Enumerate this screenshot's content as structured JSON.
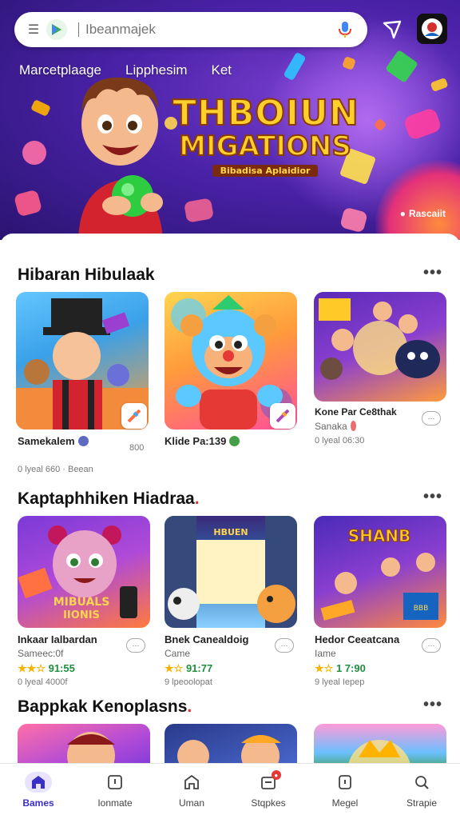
{
  "search": {
    "placeholder": "Ibeanmajek"
  },
  "hero": {
    "tabs": [
      {
        "label": "Marcetplaage"
      },
      {
        "label": "Lipphesim"
      },
      {
        "label": "Ket"
      }
    ],
    "title_line1": "THBOIUN",
    "title_line2": "MIGATIONS",
    "subtitle": "Bibadisa Aplaidior",
    "badge": "Rascaiit"
  },
  "sections": [
    {
      "title": "Hibaran Hibulaak",
      "cards": [
        {
          "name": "Samekalem",
          "dev": "",
          "meta": "0 lyeal 660  ·  Beean",
          "rating": "",
          "aux": "800"
        },
        {
          "name": "Klide Pa:139",
          "dev": "",
          "meta": "",
          "rating": "",
          "aux": ""
        },
        {
          "name": "Kone Par Ce8thak",
          "dev": "Sanaka",
          "meta": "0 lyeal 06:30",
          "rating": "",
          "aux": ""
        }
      ]
    },
    {
      "title": "Kaptaphhiken Hiadraa",
      "cards": [
        {
          "name": "Inkaar Ialbardan",
          "dev": "Sameec:0f",
          "meta": "0 lyeal 4000f",
          "rating": "91:55",
          "aux": ""
        },
        {
          "name": "Bnek Canealdoig",
          "dev": "Came",
          "meta": "9 lpeoolopat",
          "rating": "91:77",
          "aux": ""
        },
        {
          "name": "Hedor Ceeatcana",
          "dev": "Iame",
          "meta": "9 lyeal Iepep",
          "rating": "1 7:90",
          "aux": ""
        }
      ]
    },
    {
      "title": "Bappkak Kenoplasns",
      "cards": []
    }
  ],
  "nav": [
    {
      "label": "Bames"
    },
    {
      "label": "Ionmate"
    },
    {
      "label": "Uman"
    },
    {
      "label": "Stqpkes"
    },
    {
      "label": "Megel"
    },
    {
      "label": "Strapie"
    }
  ],
  "colors": {
    "accent": "#3b2fc9",
    "hero_bg": "#4a22a8",
    "rating": "#1e8e3e",
    "stars": "#f4b400"
  },
  "icons": [
    "menu-icon",
    "play-logo-icon",
    "mic-icon",
    "share-icon",
    "avatar-icon",
    "more-icon",
    "games-icon",
    "apps-icon",
    "home-icon",
    "updates-icon",
    "library-icon",
    "search-icon"
  ]
}
